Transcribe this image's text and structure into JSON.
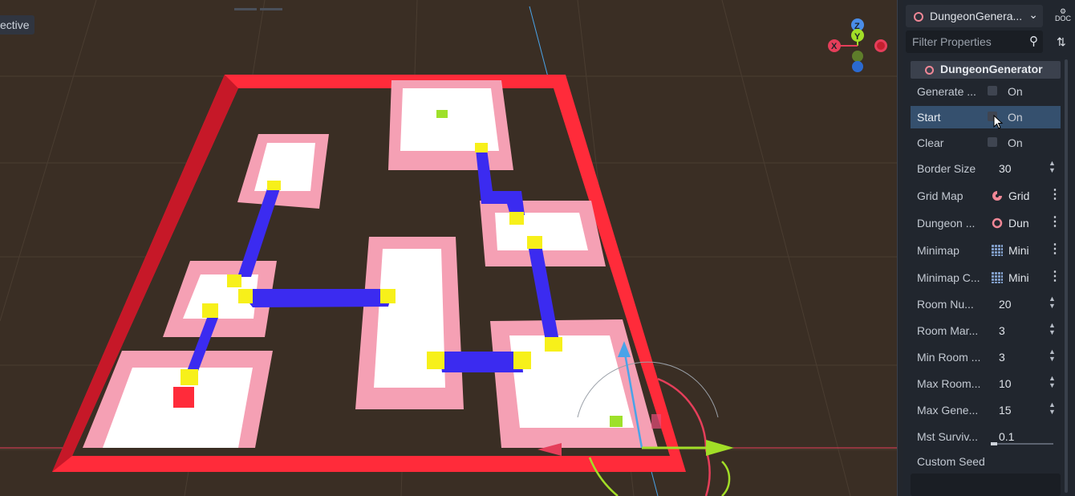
{
  "viewport": {
    "view_label": "ective",
    "gizmo": {
      "z_label": "Z",
      "y_label": "Y",
      "x_label": "X"
    }
  },
  "inspector": {
    "node_selector": {
      "name": "DungeonGenera...",
      "chevron": "chevron-down-icon"
    },
    "doc_button": "DOC",
    "filter": {
      "placeholder": "Filter Properties",
      "icon": "search-icon"
    },
    "section_title": "DungeonGenerator",
    "properties": [
      {
        "label": "Generate ...",
        "type": "bool",
        "value": "On"
      },
      {
        "label": "Start",
        "type": "bool",
        "value": "On",
        "highlighted": true
      },
      {
        "label": "Clear",
        "type": "bool",
        "value": "On"
      },
      {
        "label": "Border Size",
        "type": "int",
        "value": "30"
      },
      {
        "label": "Grid Map",
        "type": "resource",
        "value": "Grid",
        "icon": "gridmap-icon"
      },
      {
        "label": "Dungeon ...",
        "type": "resource",
        "value": "Dun",
        "icon": "node-ring-icon"
      },
      {
        "label": "Minimap",
        "type": "resource",
        "value": "Mini",
        "icon": "tilemap-icon"
      },
      {
        "label": "Minimap C...",
        "type": "resource",
        "value": "Mini",
        "icon": "tilemap-icon"
      },
      {
        "label": "Room Nu...",
        "type": "int",
        "value": "20"
      },
      {
        "label": "Room Mar...",
        "type": "int",
        "value": "3"
      },
      {
        "label": "Min Room ...",
        "type": "int",
        "value": "3"
      },
      {
        "label": "Max Room...",
        "type": "int",
        "value": "10"
      },
      {
        "label": "Max Gene...",
        "type": "int",
        "value": "15"
      },
      {
        "label": "Mst Surviv...",
        "type": "float",
        "value": "0.1",
        "fraction": 0.1
      },
      {
        "label": "Custom Seed",
        "type": "string",
        "value": ""
      }
    ]
  },
  "colors": {
    "floor": "#3a2e24",
    "border": "#ff2b3a",
    "room_rim": "#f5a0b4",
    "room_floor": "#ffffff",
    "corridor": "#3b2bf0",
    "door": "#f7f01a",
    "accent_selected": "#35506e"
  }
}
